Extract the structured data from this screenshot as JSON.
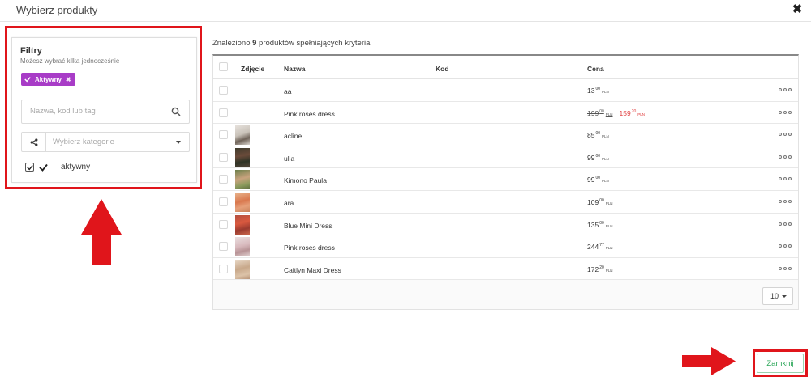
{
  "modal": {
    "title": "Wybierz produkty"
  },
  "filters": {
    "title": "Filtry",
    "subtitle": "Możesz wybrać kilka jednocześnie",
    "tag_label": "Aktywny",
    "search_placeholder": "Nazwa, kod lub tag",
    "category_placeholder": "Wybierz kategorie",
    "checkbox_label": "aktywny"
  },
  "results": {
    "prefix": "Znaleziono ",
    "count": "9",
    "suffix": " produktów spełniających kryteria"
  },
  "table": {
    "headers": {
      "photo": "Zdjęcie",
      "name": "Nazwa",
      "code": "Kod",
      "price": "Cena"
    },
    "rows": [
      {
        "name": "aa",
        "price_int": "13",
        "price_dec": "00",
        "currency": "PLN"
      },
      {
        "name": "Pink roses dress",
        "old_int": "199",
        "old_dec": "00",
        "price_int": "159",
        "price_dec": "20",
        "currency": "PLN"
      },
      {
        "name": "acline",
        "price_int": "85",
        "price_dec": "00",
        "currency": "PLN"
      },
      {
        "name": "ulia",
        "price_int": "99",
        "price_dec": "00",
        "currency": "PLN"
      },
      {
        "name": "Kimono Paula",
        "price_int": "99",
        "price_dec": "00",
        "currency": "PLN"
      },
      {
        "name": "ara",
        "price_int": "109",
        "price_dec": "00",
        "currency": "PLN"
      },
      {
        "name": "Blue Mini Dress",
        "price_int": "135",
        "price_dec": "00",
        "currency": "PLN"
      },
      {
        "name": "Pink roses dress",
        "price_int": "244",
        "price_dec": "77",
        "currency": "PLN"
      },
      {
        "name": "Caitlyn Maxi Dress",
        "price_int": "172",
        "price_dec": "20",
        "currency": "PLN"
      }
    ],
    "per_page": "10"
  },
  "footer": {
    "close_label": "Zamknij"
  },
  "colors": {
    "tag": "#a83cc7",
    "annotation": "#e0151b",
    "sale_price": "#e03b3b",
    "button_text": "#2ea85b"
  }
}
